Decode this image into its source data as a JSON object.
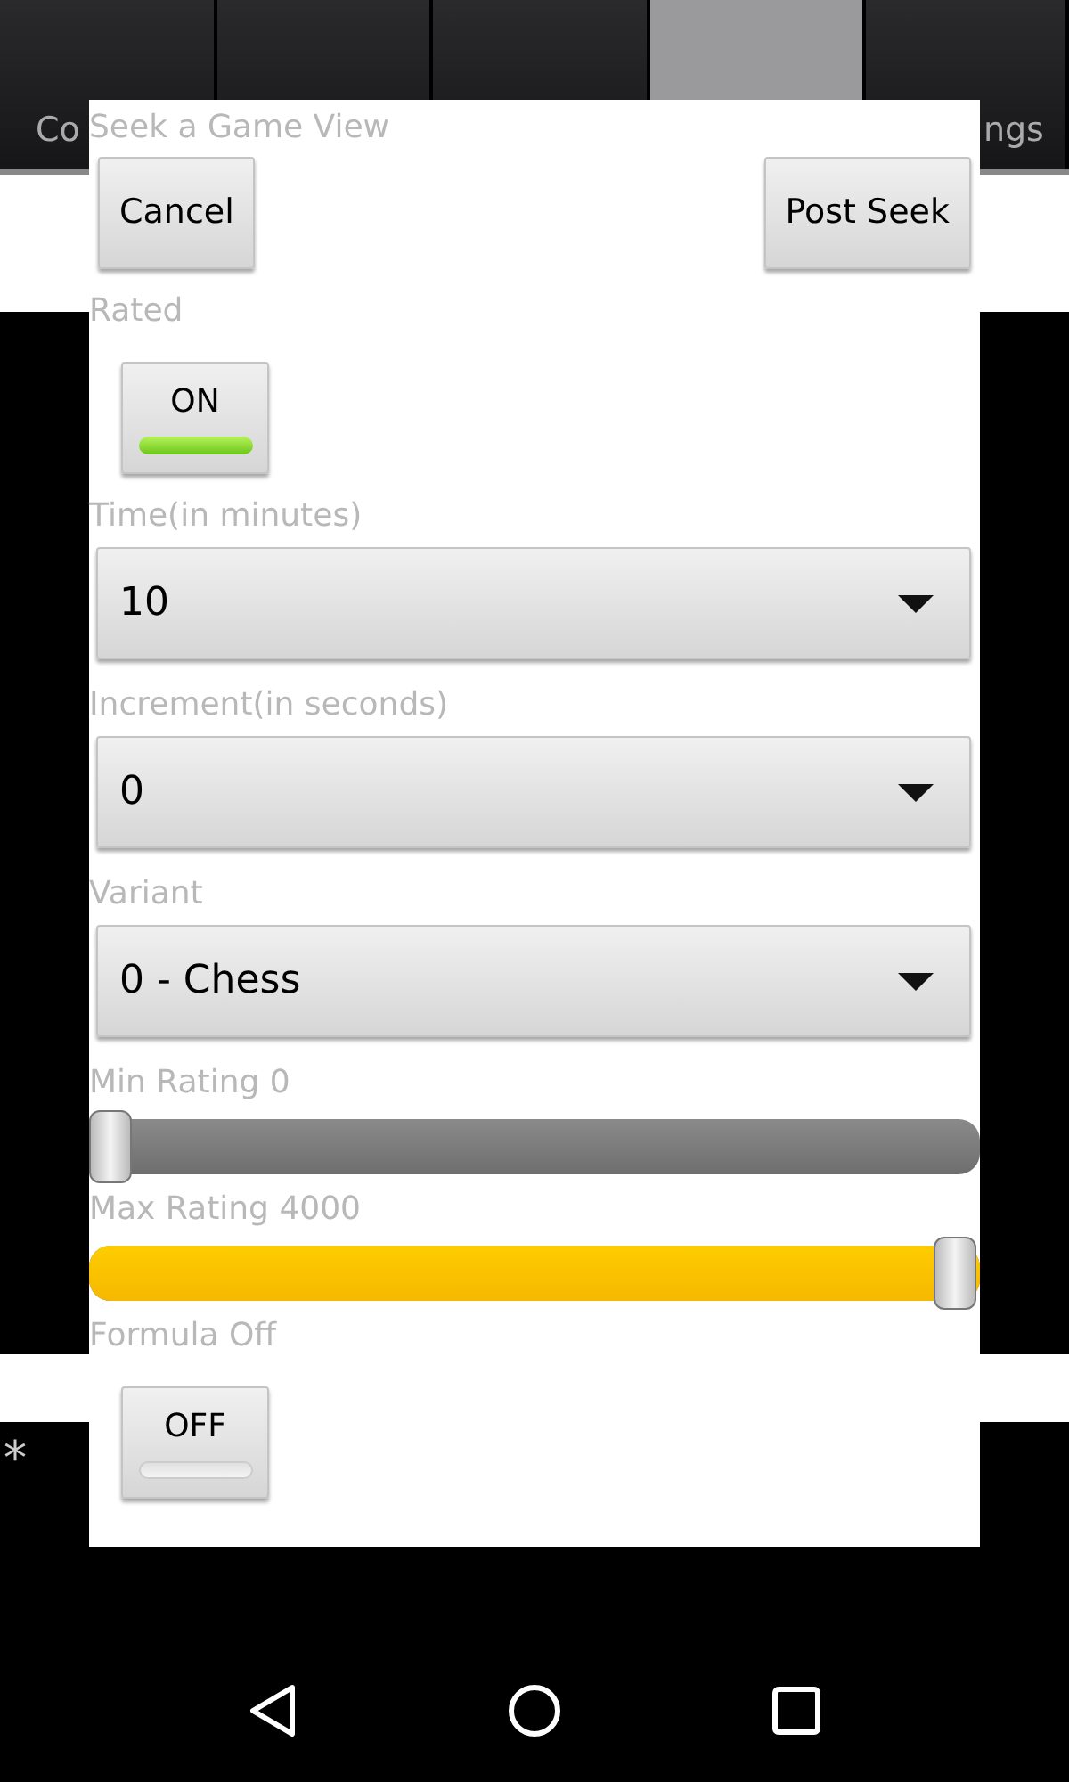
{
  "background_tabs": [
    {
      "label": "Co",
      "selected": false
    },
    {
      "selected": false
    },
    {
      "selected": false
    },
    {
      "selected": true
    },
    {
      "label": "ngs",
      "selected": false
    }
  ],
  "background_mark": "*",
  "dialog": {
    "title": "Seek a Game View",
    "buttons": [
      {
        "label": "Cancel"
      },
      {
        "label": "Post Seek"
      }
    ],
    "fields": [
      {
        "kind": "toggle",
        "label": "Rated",
        "value": "ON",
        "on": true
      },
      {
        "kind": "dropdown",
        "label": "Time(in minutes)",
        "value": "10"
      },
      {
        "kind": "dropdown",
        "label": "Increment(in seconds)",
        "value": "0"
      },
      {
        "kind": "dropdown",
        "label": "Variant",
        "value": "0 - Chess"
      },
      {
        "kind": "slider",
        "label": "Min Rating 0",
        "level": 0
      },
      {
        "kind": "slider",
        "label": "Max Rating 4000",
        "level": 1
      },
      {
        "kind": "toggle",
        "label": "Formula Off",
        "value": "OFF",
        "on": false
      }
    ]
  }
}
